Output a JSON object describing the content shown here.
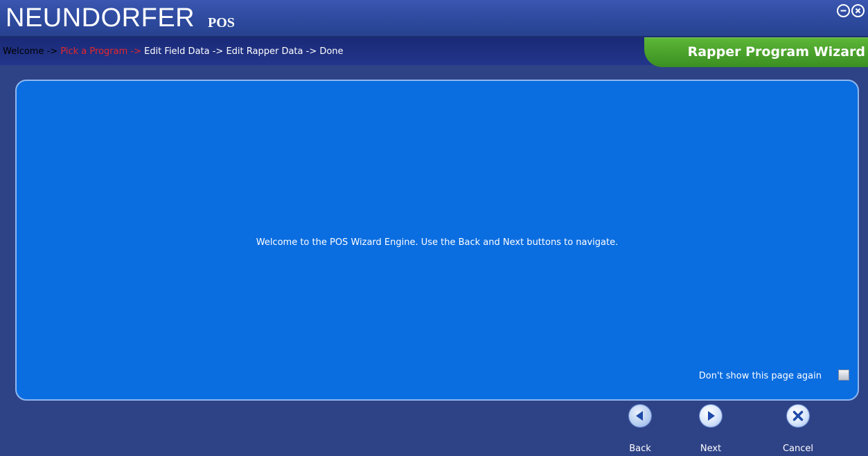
{
  "app": {
    "brand": "NEUNDORFER",
    "brand_sub": "POS"
  },
  "window_controls": {
    "minimize_icon": "minimize-circle-icon",
    "close_icon": "close-circle-icon"
  },
  "breadcrumb": {
    "welcome": "Welcome -> ",
    "pick_program": "Pick a Program -> ",
    "edit_field": "Edit Field Data -> ",
    "edit_rapper": "Edit Rapper Data -> ",
    "done": "Done"
  },
  "wizard": {
    "title": "Rapper Program Wizard"
  },
  "main": {
    "welcome_text": "Welcome to the POS Wizard Engine. Use the Back and Next buttons to navigate.",
    "dont_show_label": "Don't show this page again",
    "dont_show_checked": false
  },
  "footer": {
    "back_label": "Back",
    "next_label": "Next",
    "cancel_label": "Cancel"
  },
  "colors": {
    "background": "#2e4286",
    "panel": "#0a6de0",
    "accent_green": "#4aa12c",
    "active_step": "#e8272b"
  }
}
